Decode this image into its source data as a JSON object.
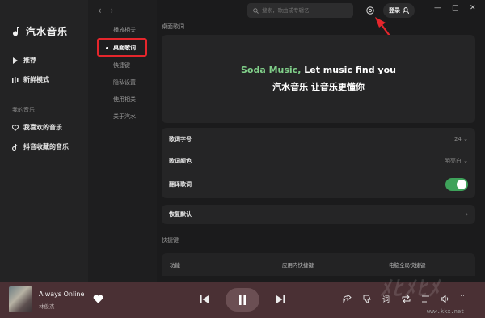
{
  "app": {
    "title": "汽水音乐"
  },
  "sidebar": {
    "items": [
      {
        "label": "推荐",
        "icon": "play-icon"
      },
      {
        "label": "新鲜模式",
        "icon": "bars-icon"
      }
    ],
    "section_title": "我的音乐",
    "my_music": [
      {
        "label": "我喜欢的音乐",
        "icon": "heart-icon"
      },
      {
        "label": "抖音收藏的音乐",
        "icon": "tiktok-icon"
      }
    ]
  },
  "settings_menu": {
    "items": [
      {
        "label": "播放相关"
      },
      {
        "label": "桌面歌词",
        "active": true
      },
      {
        "label": "快捷键"
      },
      {
        "label": "隐私设置"
      },
      {
        "label": "使用相关"
      },
      {
        "label": "关于汽水"
      }
    ]
  },
  "topbar": {
    "search_placeholder": "搜索，歌曲或专辑名",
    "login_label": "登录",
    "window": {
      "minimize": "—",
      "maximize": "□",
      "close": "✕"
    }
  },
  "lyrics": {
    "section_title": "桌面歌词",
    "preview_accent": "Soda Music,",
    "preview_rest": " Let music find you",
    "preview_cn": "汽水音乐 让音乐更懂你",
    "font_size_label": "歌词字号",
    "font_size_value": "24",
    "color_label": "歌词颜色",
    "color_value": "明亮白",
    "translate_label": "翻译歌词",
    "translate_on": true,
    "reset_label": "恢复默认"
  },
  "shortcuts": {
    "section_title": "快捷键",
    "columns": [
      "功能",
      "应用内快捷键",
      "电脑全局快捷键"
    ]
  },
  "player": {
    "song": "Always Online",
    "artist": "林俊杰",
    "lyrics_button": "词"
  },
  "watermark": "www.kkx.net",
  "colors": {
    "accent_green": "#3ea25a",
    "lyric_green": "#81d08a",
    "highlight_red": "#e5262c",
    "player_bg": "#4a3034"
  }
}
